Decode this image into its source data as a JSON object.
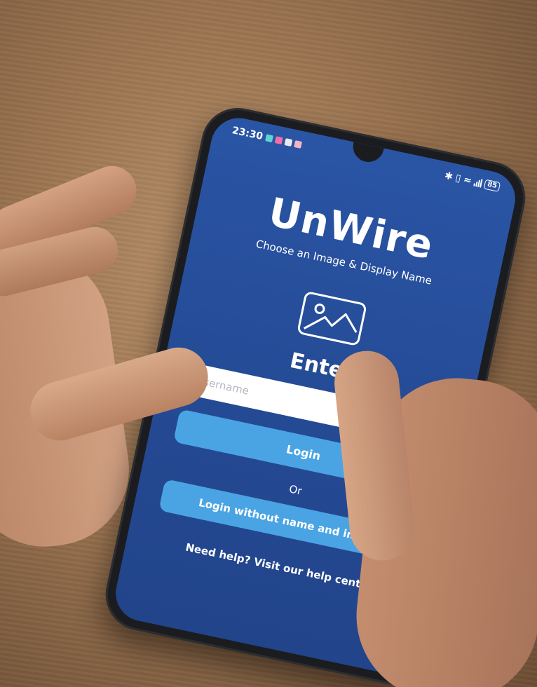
{
  "status_bar": {
    "time": "23:30",
    "battery": "85"
  },
  "app": {
    "title": "UnWire",
    "subtitle": "Choose an Image & Display Name"
  },
  "form": {
    "heading": "Enter",
    "username_placeholder": "Username",
    "username_value": "",
    "login_label": "Login",
    "or_label": "Or",
    "guest_login_label": "Login without name and image",
    "help_text": "Need help? Visit our help center"
  },
  "colors": {
    "screen_bg": "#2a55a5",
    "button_bg": "#4aa4e3"
  },
  "icons": {
    "image_picker": "image-placeholder-icon"
  }
}
